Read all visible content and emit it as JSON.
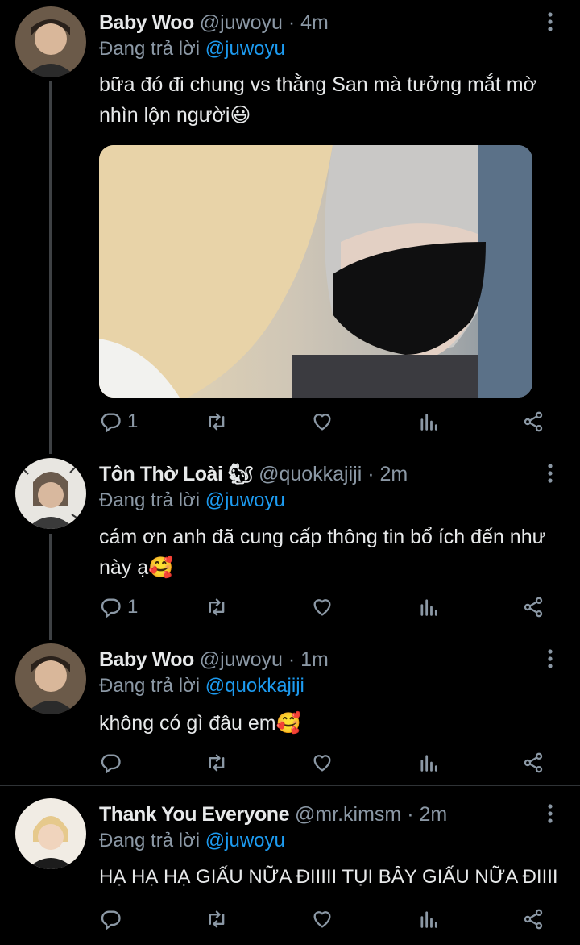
{
  "tweets": [
    {
      "name": "Baby Woo",
      "handle": "@juwoyu",
      "time": "· 4m",
      "reply_prefix": "Đang trả lời",
      "reply_to": "@juwoyu",
      "text": "bữa đó đi chung vs thằng San mà tưởng mắt mờ nhìn lộn người😃",
      "reply_count": "1"
    },
    {
      "name": "Tôn Thờ Loài 🐿",
      "handle": "@quokkajiji",
      "time": "· 2m",
      "reply_prefix": "Đang trả lời",
      "reply_to": "@juwoyu",
      "text": "cám ơn anh đã cung cấp thông tin bổ ích đến như này ạ🥰",
      "reply_count": "1"
    },
    {
      "name": "Baby Woo",
      "handle": "@juwoyu",
      "time": "· 1m",
      "reply_prefix": "Đang trả lời",
      "reply_to": "@quokkajiji",
      "text": "không có gì đâu em🥰",
      "reply_count": ""
    },
    {
      "name": "Thank You Everyone",
      "handle": "@mr.kimsm",
      "time": "· 2m",
      "reply_prefix": "Đang trả lời",
      "reply_to": "@juwoyu",
      "text": "HẠ HẠ HẠ GIẤU NỮA ĐIIIII TỤI BÂY GIẤU NỮA ĐIIII",
      "reply_count": ""
    }
  ],
  "colors": {
    "background": "#000000",
    "mention": "#1d9bf0",
    "muted": "#8b98a5",
    "text": "#e7e9ea"
  },
  "icons": [
    "reply-icon",
    "retweet-icon",
    "like-icon",
    "analytics-icon",
    "share-icon",
    "more-icon"
  ]
}
